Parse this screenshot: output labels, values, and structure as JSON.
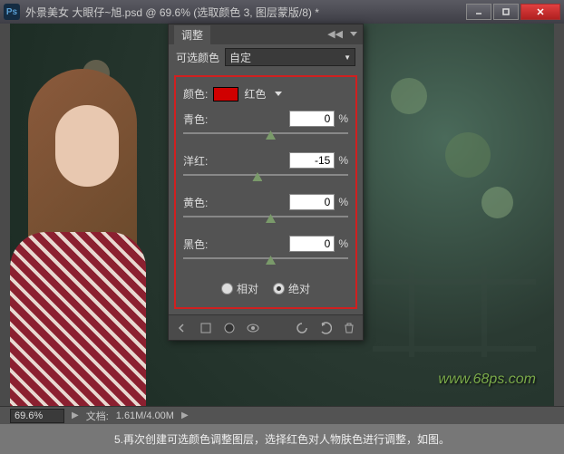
{
  "window": {
    "ps_icon": "Ps",
    "title": "外景美女 大眼仔~旭.psd @ 69.6% (选取颜色 3, 图层蒙版/8) *"
  },
  "panel": {
    "tab": "调整",
    "preset_label": "可选颜色",
    "preset_value": "自定",
    "color_label": "颜色:",
    "color_value": "红色",
    "sliders": [
      {
        "label": "青色:",
        "value": "0",
        "thumb_pct": 50
      },
      {
        "label": "洋红:",
        "value": "-15",
        "thumb_pct": 42
      },
      {
        "label": "黄色:",
        "value": "0",
        "thumb_pct": 50
      },
      {
        "label": "黑色:",
        "value": "0",
        "thumb_pct": 50
      }
    ],
    "pct_sign": "%",
    "method": {
      "relative": "相对",
      "absolute": "绝对",
      "selected": "absolute"
    }
  },
  "statusbar": {
    "zoom": "69.6%",
    "doc_label": "文档:",
    "doc_size": "1.61M/4.00M"
  },
  "watermark": "www.68ps.com",
  "caption": "5.再次创建可选颜色调整图层，选择红色对人物肤色进行调整，如图。",
  "colors": {
    "red_swatch": "#d00000",
    "highlight_box": "#d02020"
  }
}
